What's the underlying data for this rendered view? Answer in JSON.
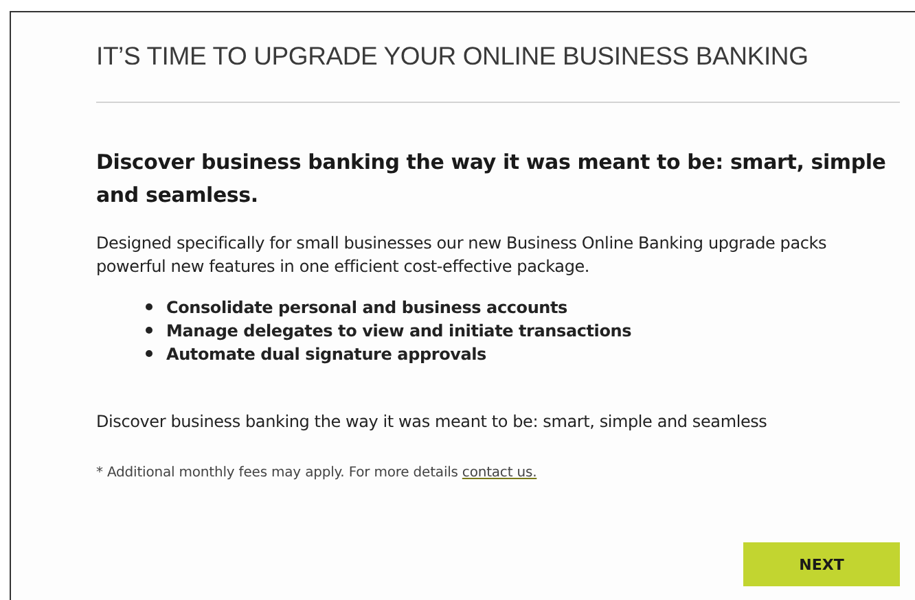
{
  "title": "IT’S TIME TO UPGRADE YOUR ONLINE BUSINESS BANKING",
  "headline": "Discover business banking the way it was meant to be: smart, simple and seamless.",
  "intro": "Designed specifically for small businesses our new Business Online Banking upgrade packs powerful new features in one efficient cost-effective package.",
  "features": [
    "Consolidate personal and business accounts",
    "Manage delegates to view and initiate transactions",
    "Automate dual signature approvals"
  ],
  "tagline": "Discover business banking the way it was meant to be: smart, simple and seamless",
  "footnote": {
    "text": "* Additional monthly fees may apply. For more details",
    "link": "contact us."
  },
  "buttons": [
    "NEXT"
  ]
}
